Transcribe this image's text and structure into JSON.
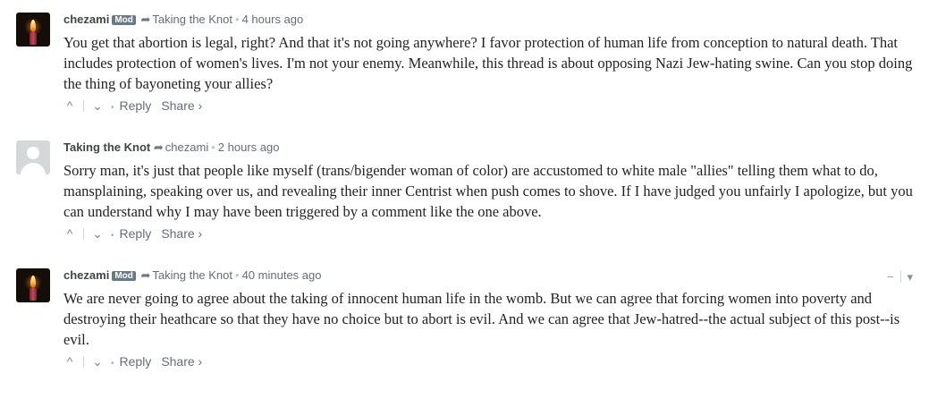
{
  "comments": [
    {
      "author": "chezami",
      "badge": "Mod",
      "parent": "Taking the Knot",
      "time": "4 hours ago",
      "text": "You get that abortion is legal, right? And that it's not going anywhere? I favor protection of human life from conception to natural death. That includes protection of women's lives. I'm not your enemy. Meanwhile, this thread is about opposing Nazi Jew-hating swine. Can you stop doing the thing of bayoneting your allies?",
      "reply": "Reply",
      "share": "Share ›"
    },
    {
      "author": "Taking the Knot",
      "parent": "chezami",
      "time": "2 hours ago",
      "text": "Sorry man, it's just that people like myself (trans/bigender woman of color) are accustomed to white male \"allies\" telling them what to do, mansplaining, speaking over us, and revealing their inner Centrist when push comes to shove. If I have judged you unfairly I apologize, but you can understand why I may have been triggered by a comment like the one above.",
      "reply": "Reply",
      "share": "Share ›"
    },
    {
      "author": "chezami",
      "badge": "Mod",
      "parent": "Taking the Knot",
      "time": "40 minutes ago",
      "text": "We are never going to agree about the taking of innocent human life in the womb. But we can agree that forcing women into poverty and destroying their heathcare so that they have no choice but to abort is evil. And we can agree that Jew-hatred--the actual subject of this post--is evil.",
      "reply": "Reply",
      "share": "Share ›",
      "collapse": "−",
      "menu": "▾"
    }
  ],
  "glyphs": {
    "arrow": "➦",
    "dot": "•",
    "upvote": "^",
    "downvote": "⌄",
    "footer_dot": "•"
  },
  "icons": {
    "avatar_1": "candle-avatar-icon",
    "avatar_2": "default-user-avatar-icon",
    "avatar_3": "candle-avatar-icon",
    "reply_arrow": "reply-arrow-icon",
    "upvote": "upvote-icon",
    "downvote": "downvote-icon"
  },
  "colors": {
    "badge": "#687a86",
    "meta": "#656c7a",
    "text": "#222222"
  }
}
